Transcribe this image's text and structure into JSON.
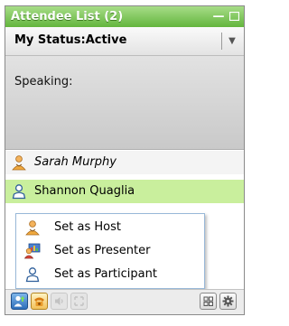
{
  "window": {
    "title": "Attendee List (2)"
  },
  "status": {
    "label": "My Status:Active"
  },
  "speaking": {
    "label": "Speaking:"
  },
  "attendees": [
    {
      "name": "Sarah Murphy",
      "role_icon": "host-icon"
    },
    {
      "name": "Shannon Quaglia",
      "role_icon": "participant-icon"
    }
  ],
  "context_menu": {
    "items": [
      {
        "label": "Set as Host",
        "icon": "host-icon"
      },
      {
        "label": "Set as Presenter",
        "icon": "presenter-icon"
      },
      {
        "label": "Set as Participant",
        "icon": "participant-icon"
      }
    ]
  },
  "toolbar": {
    "buttons": [
      "attendee-role-icon",
      "phone-icon",
      "mute-icon",
      "expand-icon",
      "grid-view-icon",
      "gear-icon"
    ]
  },
  "colors": {
    "title_bar": "#6cbd45",
    "selected_row": "#c9ef9d",
    "menu_border": "#98b8d8"
  }
}
